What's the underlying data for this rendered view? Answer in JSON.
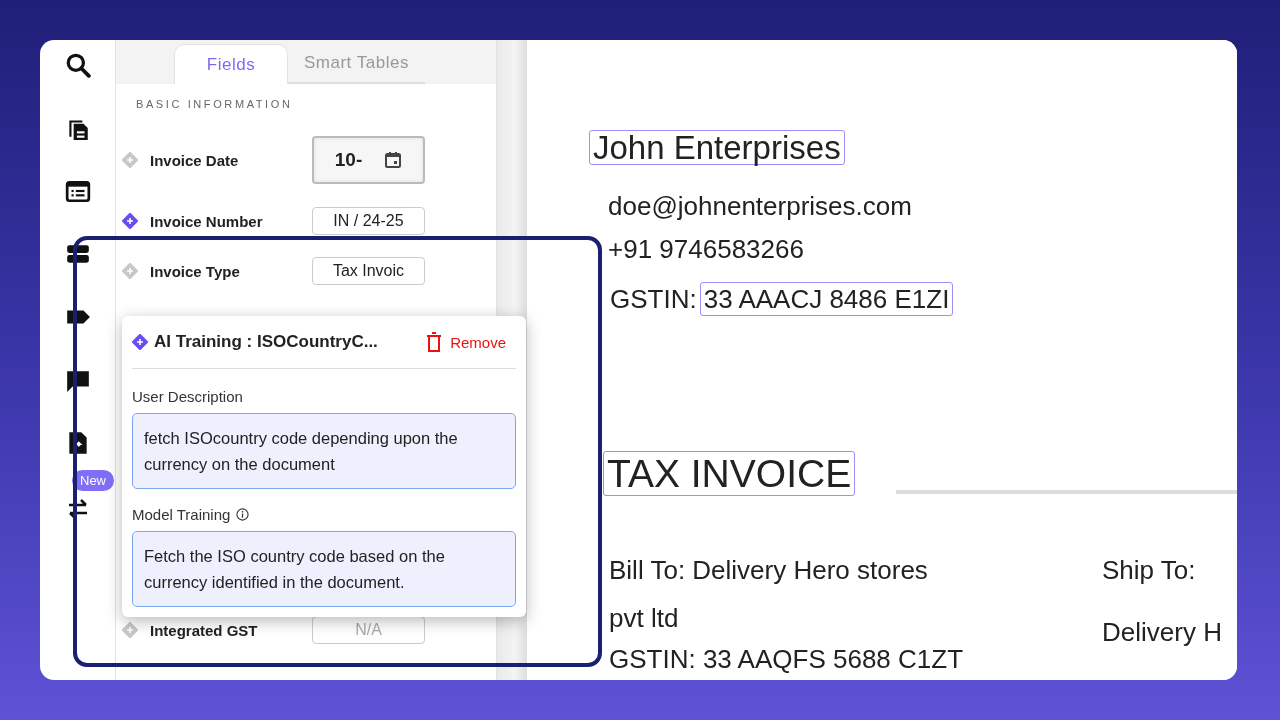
{
  "rail": {
    "badge": "New"
  },
  "tabs": [
    {
      "label": "Fields",
      "selected": true
    },
    {
      "label": "Smart Tables",
      "selected": false
    }
  ],
  "section_title": "BASIC INFORMATION",
  "fields": [
    {
      "label": "Invoice Date",
      "ai_trained": false,
      "kind": "date",
      "value": "10-"
    },
    {
      "label": "Invoice Number",
      "ai_trained": true,
      "kind": "text",
      "value": "IN / 24-25"
    },
    {
      "label": "Invoice Type",
      "ai_trained": false,
      "kind": "text",
      "value": "Tax Invoic"
    },
    {
      "label": "Integrated GST",
      "ai_trained": false,
      "kind": "text",
      "placeholder": "N/A"
    }
  ],
  "popup": {
    "title": "AI Training : ISOCountryC...",
    "remove_label": "Remove",
    "user_description": {
      "label": "User Description",
      "value": "fetch ISOcountry code depending upon the currency on the document"
    },
    "model_training": {
      "label": "Model Training",
      "value": "Fetch the ISO country code based on the currency identified in the document."
    }
  },
  "document": {
    "company": {
      "text": "John Enterprises",
      "highlighted": true
    },
    "email": "doe@johnenterprises.com",
    "phone": "+91 9746583266",
    "gstin_label": "GSTIN:",
    "gstin": {
      "text": "33 AAACJ 8486 E1ZI",
      "highlighted": true
    },
    "title": {
      "text": "TAX INVOICE",
      "highlighted": true
    },
    "bill_to": [
      "Bill To: Delivery Hero stores",
      "pvt ltd",
      "GSTIN: 33 AAQFS 5688 C1ZT"
    ],
    "ship_to": [
      "Ship To:",
      "Delivery H"
    ]
  }
}
